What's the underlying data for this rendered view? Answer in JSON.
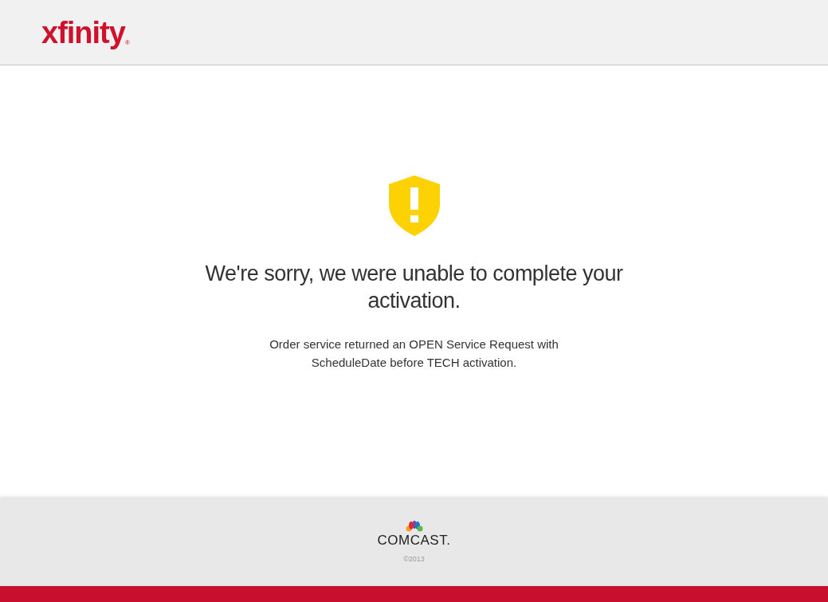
{
  "header": {
    "logo": "xfinity",
    "trademark": "®"
  },
  "message": {
    "title": "We're sorry, we were unable to complete your activation.",
    "detail": "Order service returned an OPEN Service Request with ScheduleDate before TECH activation."
  },
  "footer": {
    "brand": "COMCAST.",
    "copyright": "©2013"
  }
}
